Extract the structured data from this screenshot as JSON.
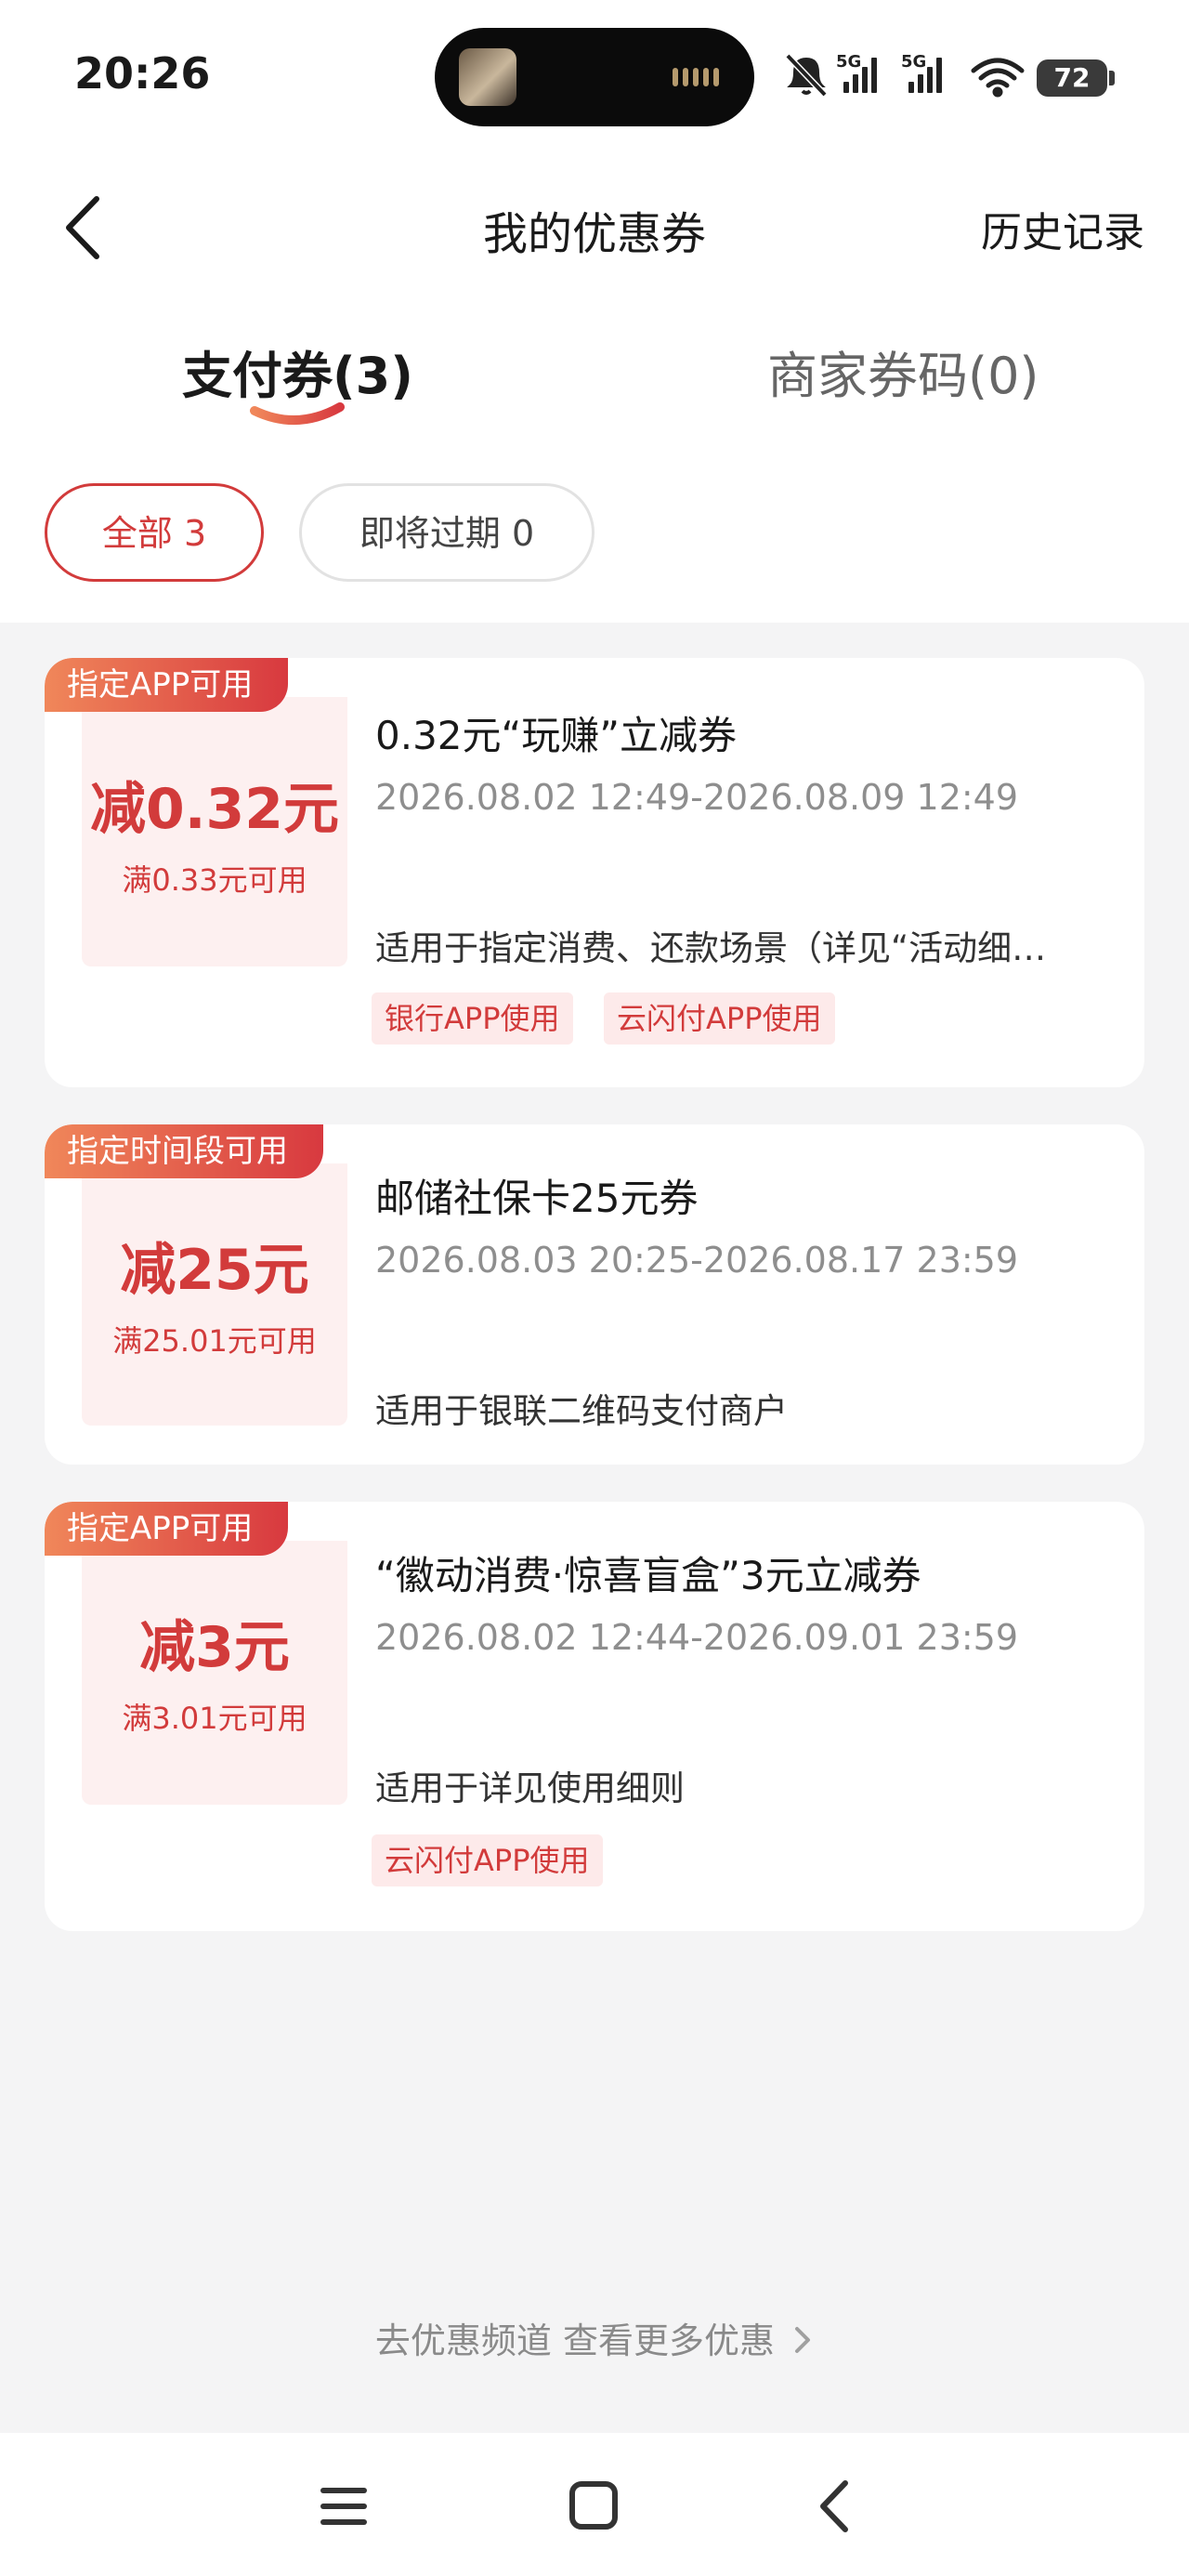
{
  "status_bar": {
    "time": "20:26",
    "battery": "72",
    "network_1": "5G",
    "network_2": "5G",
    "icons": [
      "dynamic-island-avatar",
      "bell-muted-icon",
      "signal-5g-icon",
      "signal-5g-icon",
      "wifi-icon",
      "battery-icon"
    ]
  },
  "nav": {
    "title": "我的优惠券",
    "history": "历史记录",
    "back_icon": "chevron-left-icon"
  },
  "tabs": [
    {
      "label": "支付券(3)",
      "active": true
    },
    {
      "label": "商家券码(0)",
      "active": false
    }
  ],
  "filters": [
    {
      "label": "全部 3",
      "active": true
    },
    {
      "label": "即将过期 0",
      "active": false
    }
  ],
  "coupons": [
    {
      "badge": "指定APP可用",
      "amount": "减0.32元",
      "condition": "满0.33元可用",
      "title": "0.32元“玩赚”立减券",
      "date": "2026.08.02 12:49-2026.08.09 12:49",
      "desc": "适用于指定消费、还款场景（详见“活动细…",
      "tags": [
        "银行APP使用",
        "云闪付APP使用"
      ]
    },
    {
      "badge": "指定时间段可用",
      "amount": "减25元",
      "condition": "满25.01元可用",
      "title": "邮储社保卡25元券",
      "date": "2026.08.03 20:25-2026.08.17 23:59",
      "desc": "适用于银联二维码支付商户",
      "tags": []
    },
    {
      "badge": "指定APP可用",
      "amount": "减3元",
      "condition": "满3.01元可用",
      "title": "“徽动消费·惊喜盲盒”3元立减券",
      "date": "2026.08.02 12:44-2026.09.01 23:59",
      "desc": "适用于详见使用细则",
      "tags": [
        "云闪付APP使用"
      ]
    }
  ],
  "footer": {
    "more_link": "去优惠频道 查看更多优惠",
    "arrow_icon": "chevron-right-icon"
  },
  "system_nav": {
    "icons": [
      "menu-icon",
      "home-square-icon",
      "back-icon"
    ]
  },
  "colors": {
    "accent": "#d23b3b",
    "accent_light": "#fdeaea",
    "coupon_panel": "#fdf0f0",
    "badge_start": "#f0875a",
    "badge_end": "#d8393f",
    "page_bg": "#f4f4f5"
  }
}
